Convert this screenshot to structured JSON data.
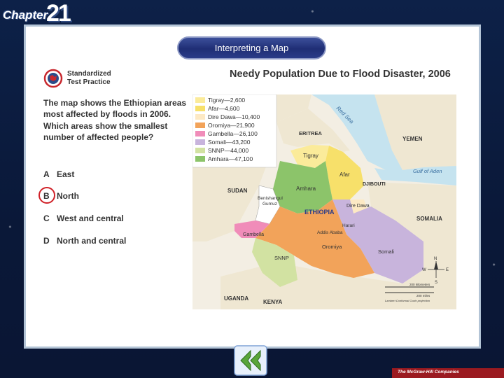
{
  "header": {
    "chapter_word": "Chapter",
    "chapter_number": "21"
  },
  "tab": {
    "label": "Interpreting a Map"
  },
  "badge": {
    "line1": "Standardized",
    "line2": "Test Practice"
  },
  "map": {
    "title": "Needy Population Due to Flood Disaster, 2006",
    "legend": [
      {
        "label": "Tigray—2,600",
        "color": "#fbeb9a"
      },
      {
        "label": "Afar—4,600",
        "color": "#f7e06a"
      },
      {
        "label": "Dire Dawa—10,400",
        "color": "#fde9c4"
      },
      {
        "label": "Oromiya—21,900",
        "color": "#f2a35a"
      },
      {
        "label": "Gambella—26,100",
        "color": "#f08cb9"
      },
      {
        "label": "Somali—43,200",
        "color": "#c8b4dc"
      },
      {
        "label": "SNNP—44,000",
        "color": "#d2e2a2"
      },
      {
        "label": "Amhara—47,100",
        "color": "#8cc46a"
      }
    ],
    "labels": {
      "red_sea": "Red Sea",
      "eritrea": "ERITREA",
      "yemen": "YEMEN",
      "gulf_aden": "Gulf of Aden",
      "djibouti": "DJIBOUTI",
      "sudan": "SUDAN",
      "tigray": "Tigray",
      "afar": "Afar",
      "amhara": "Amhara",
      "benishangul": "Benishangul",
      "gumuz": "Gumuz",
      "dire_dawa": "Dire Dawa",
      "ethiopia": "ETHIOPIA",
      "harari": "Harari",
      "addis": "Addis Ababa",
      "somalia": "SOMALIA",
      "gambella": "Gambella",
      "oromiya": "Oromiya",
      "somali": "Somali",
      "snnp": "SNNP",
      "uganda": "UGANDA",
      "kenya": "KENYA",
      "compass_n": "N",
      "compass_s": "S",
      "compass_e": "E",
      "compass_w": "W",
      "scale_km": "200 kilometers",
      "scale_mi": "200 miles",
      "scale_note": "Lambert Conformal Conic projection"
    }
  },
  "question": {
    "text": "The map shows the Ethiopian areas most affected by floods in 2006. Which areas show the smallest number of affected people?",
    "choices": [
      {
        "letter": "A",
        "text": "East"
      },
      {
        "letter": "B",
        "text": "North"
      },
      {
        "letter": "C",
        "text": "West and central"
      },
      {
        "letter": "D",
        "text": "North and central"
      }
    ]
  },
  "footer": {
    "publisher": "The McGraw-Hill Companies"
  }
}
